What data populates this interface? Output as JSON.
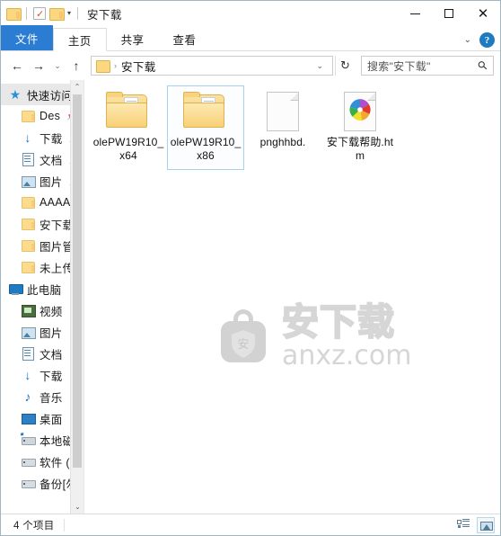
{
  "window": {
    "title": "安下载",
    "quick_access": {
      "window_icon": "folder-icon",
      "properties_icon": "properties-checkbox-icon",
      "new_folder_icon": "new-folder-icon",
      "customize_caret": "▾"
    },
    "controls": {
      "minimize": "—",
      "maximize": "□",
      "close": "✕"
    }
  },
  "ribbon": {
    "tabs": [
      {
        "label": "文件",
        "state": "file-menu"
      },
      {
        "label": "主页",
        "state": "active"
      },
      {
        "label": "共享",
        "state": "normal"
      },
      {
        "label": "查看",
        "state": "normal"
      }
    ],
    "collapse_caret": "⌄",
    "help_label": "?"
  },
  "address_bar": {
    "back": "←",
    "forward": "→",
    "recent_caret": "⌄",
    "up": "↑",
    "breadcrumb_separator": "›",
    "path": "安下载",
    "dropdown_caret": "⌄",
    "refresh": "↻"
  },
  "search": {
    "placeholder": "搜索\"安下载\"",
    "icon": "search-icon"
  },
  "sidebar": {
    "scroll_up": "⌃",
    "scroll_down": "⌄",
    "items": [
      {
        "label": "快速访问",
        "icon": "star-pin-icon",
        "indent": 0,
        "selected": true,
        "pinned": false
      },
      {
        "label": "Des",
        "icon": "folder-icon",
        "indent": 1,
        "selected": false,
        "pinned": true
      },
      {
        "label": "下载",
        "icon": "download-arrow-icon",
        "indent": 1,
        "selected": false,
        "pinned": true
      },
      {
        "label": "文档",
        "icon": "document-icon",
        "indent": 1,
        "selected": false,
        "pinned": true
      },
      {
        "label": "图片",
        "icon": "pictures-icon",
        "indent": 1,
        "selected": false,
        "pinned": true
      },
      {
        "label": "AAAAA",
        "icon": "folder-icon",
        "indent": 1,
        "selected": false,
        "pinned": false
      },
      {
        "label": "安下载",
        "icon": "folder-icon",
        "indent": 1,
        "selected": false,
        "pinned": false
      },
      {
        "label": "图片管",
        "icon": "folder-icon",
        "indent": 1,
        "selected": false,
        "pinned": false
      },
      {
        "label": "未上传",
        "icon": "folder-icon",
        "indent": 1,
        "selected": false,
        "pinned": false
      },
      {
        "label": "此电脑",
        "icon": "this-pc-icon",
        "indent": 0,
        "selected": false,
        "pinned": false
      },
      {
        "label": "视频",
        "icon": "videos-icon",
        "indent": 1,
        "selected": false,
        "pinned": false
      },
      {
        "label": "图片",
        "icon": "pictures-icon",
        "indent": 1,
        "selected": false,
        "pinned": false
      },
      {
        "label": "文档",
        "icon": "document-icon",
        "indent": 1,
        "selected": false,
        "pinned": false
      },
      {
        "label": "下载",
        "icon": "download-arrow-icon",
        "indent": 1,
        "selected": false,
        "pinned": false
      },
      {
        "label": "音乐",
        "icon": "music-note-icon",
        "indent": 1,
        "selected": false,
        "pinned": false
      },
      {
        "label": "桌面",
        "icon": "desktop-icon",
        "indent": 1,
        "selected": false,
        "pinned": false
      },
      {
        "label": "本地磁",
        "icon": "system-drive-icon",
        "indent": 1,
        "selected": false,
        "pinned": false
      },
      {
        "label": "软件 (D",
        "icon": "drive-icon",
        "indent": 1,
        "selected": false,
        "pinned": false
      },
      {
        "label": "备份[勿",
        "icon": "drive-icon",
        "indent": 1,
        "selected": false,
        "pinned": false
      }
    ]
  },
  "content": {
    "items": [
      {
        "name": "olePW19R10_x64",
        "type": "folder",
        "selected": false
      },
      {
        "name": "olePW19R10_x86",
        "type": "folder",
        "selected": true
      },
      {
        "name": "pnghhbd.",
        "type": "file",
        "selected": false
      },
      {
        "name": "安下载帮助.htm",
        "type": "html-file",
        "selected": false
      }
    ],
    "watermark": {
      "badge_text": "安",
      "brand": "安下载",
      "url": "anxz.com"
    }
  },
  "status_bar": {
    "item_count": "4 个项目",
    "views": [
      {
        "name": "details-view",
        "active": false
      },
      {
        "name": "large-icons-view",
        "active": true
      }
    ]
  },
  "colors": {
    "accent": "#2b7cd3",
    "selection_border": "#a6d2ee",
    "folder": "#f6cf72",
    "help_blue": "#1f7bc1",
    "watermark_gray": "#d6d6d6"
  }
}
